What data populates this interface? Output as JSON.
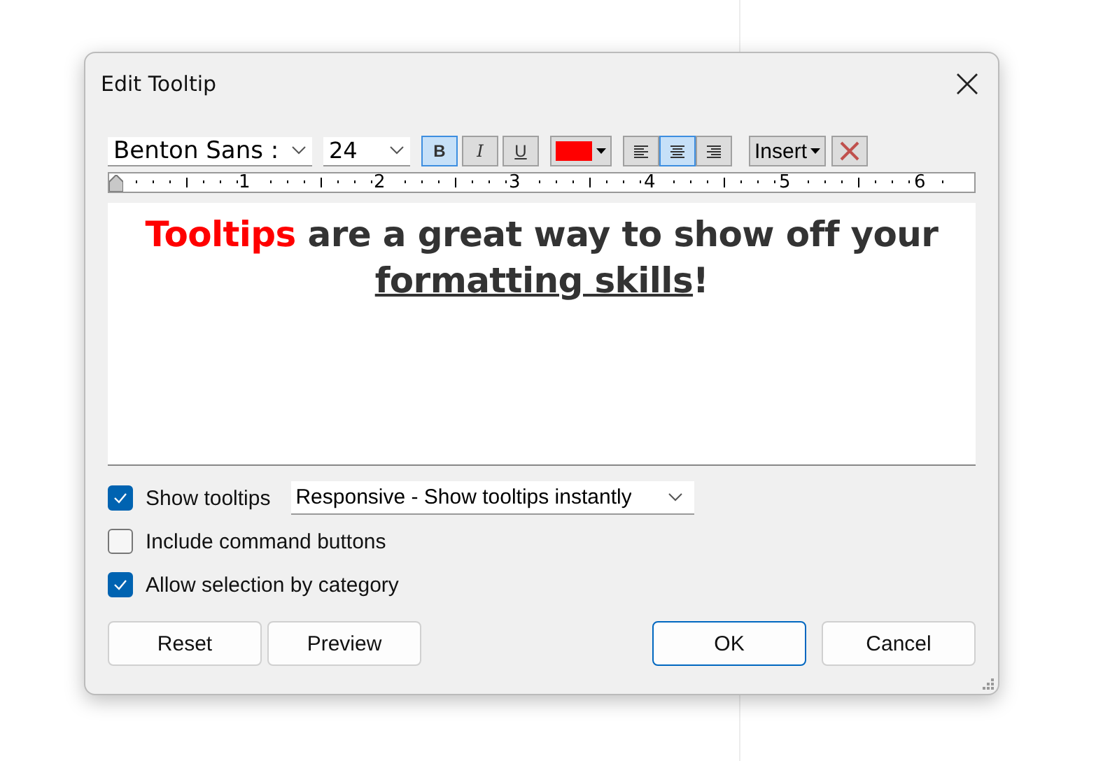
{
  "window": {
    "title": "Edit Tooltip"
  },
  "toolbar": {
    "font": "Benton Sans :",
    "size": "24",
    "styles": [
      {
        "label": "B",
        "kind": "bold",
        "selected": true
      },
      {
        "label": "I",
        "kind": "italic",
        "selected": false
      },
      {
        "label": "U",
        "kind": "underline",
        "selected": false
      }
    ],
    "color_button": {
      "color": "#ff0000"
    },
    "alignments": [
      {
        "kind": "left",
        "selected": false
      },
      {
        "kind": "center",
        "selected": true
      },
      {
        "kind": "right",
        "selected": false
      }
    ],
    "insert": "Insert"
  },
  "ruler": {
    "ticks": [
      "1",
      "2",
      "3",
      "4",
      "5",
      "6"
    ]
  },
  "editor": {
    "segments": [
      {
        "text": "Tooltips",
        "color": "#ff0000",
        "underline": false
      },
      {
        "text": " are a great way to show off your ",
        "color": "#333333",
        "underline": false
      },
      {
        "text": "formatting skills",
        "color": "#333333",
        "underline": true
      },
      {
        "text": "!",
        "color": "#333333",
        "underline": false
      }
    ]
  },
  "options": [
    {
      "label": "Show tooltips",
      "checked": true,
      "select": "Responsive - Show tooltips instantly"
    },
    {
      "label": "Include command buttons",
      "checked": false
    },
    {
      "label": "Allow selection by category",
      "checked": true
    }
  ],
  "buttons": [
    {
      "label": "Reset",
      "kind": "left"
    },
    {
      "label": "Preview",
      "kind": "left"
    },
    {
      "label": "OK",
      "kind": "default"
    },
    {
      "label": "Cancel",
      "kind": "right"
    }
  ]
}
